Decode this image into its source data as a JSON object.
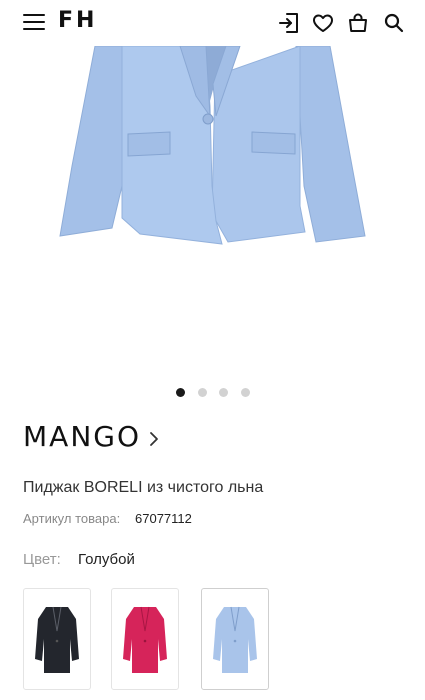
{
  "header": {
    "logo": "FH",
    "icons": [
      "menu-icon",
      "login-icon",
      "heart-icon",
      "bag-icon",
      "search-icon"
    ]
  },
  "gallery": {
    "image": "light-blue-blazer",
    "dots": 4,
    "active_dot": 1
  },
  "product": {
    "brand": "MANGO",
    "name": "Пиджак BORELI из чистого льна",
    "sku_label": "Артикул товара:",
    "sku_value": "67077112",
    "color_label": "Цвет:",
    "color_value": "Голубой",
    "colors": [
      {
        "name": "black",
        "hex": "#23262d",
        "selected": false
      },
      {
        "name": "pink",
        "hex": "#d6245a",
        "selected": false
      },
      {
        "name": "light-blue",
        "hex": "#a9c4ea",
        "selected": true
      }
    ]
  },
  "theme": {
    "blazer_blue": "#a9c4ea",
    "dot_active": "#1a1a1a",
    "dot_inactive": "#d2d2d2"
  }
}
